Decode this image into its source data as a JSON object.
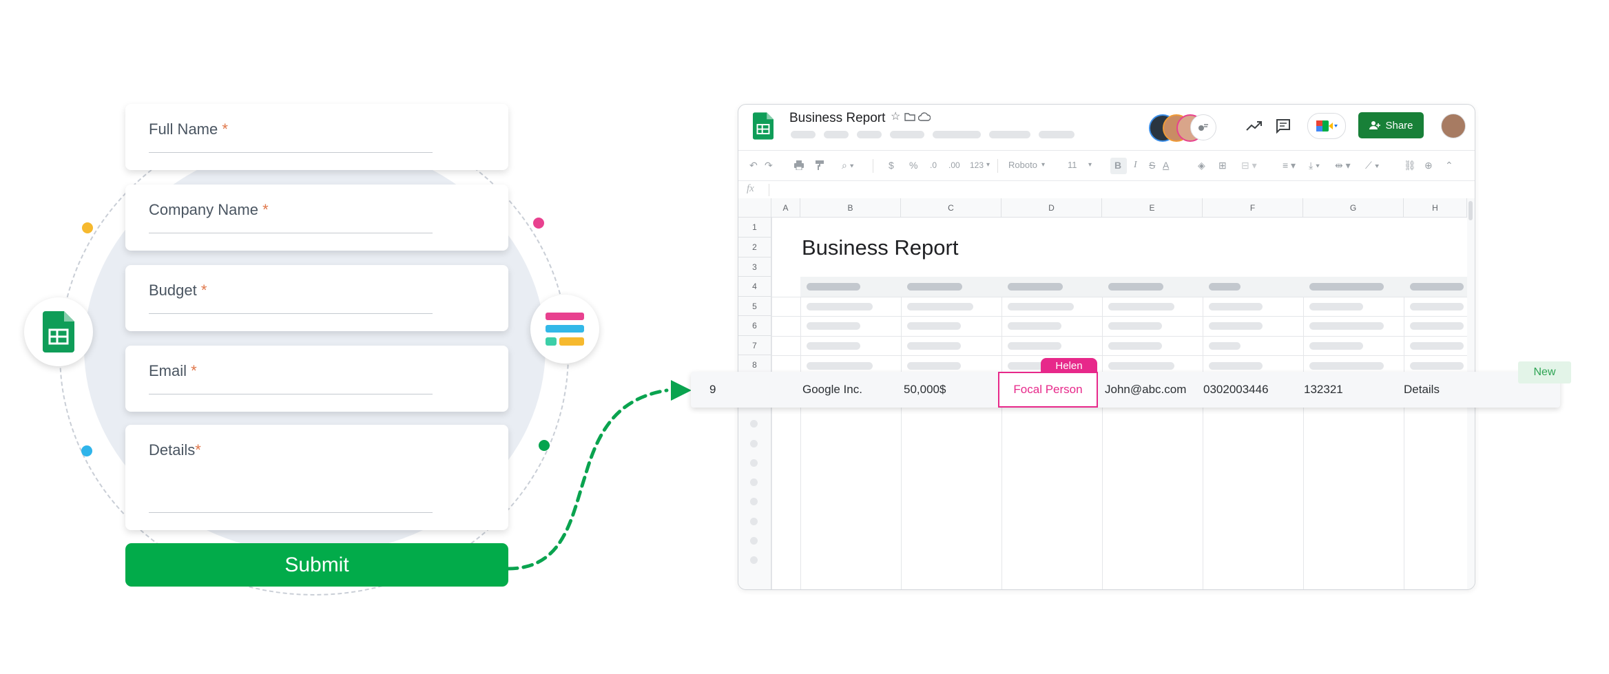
{
  "form": {
    "fields": [
      {
        "label": "Full Name",
        "required": "*"
      },
      {
        "label": "Company Name",
        "required": "*"
      },
      {
        "label": "Budget ",
        "required": "*"
      },
      {
        "label": "Email",
        "required": "*"
      },
      {
        "label": "Details",
        "required": "*"
      }
    ],
    "submit_label": "Submit"
  },
  "sheet": {
    "doc_title": "Business Report",
    "share_label": "Share",
    "font_name": "Roboto",
    "font_size": "11",
    "fx_label": "fx",
    "report_heading": "Business Report",
    "columns": [
      "A",
      "B",
      "C",
      "D",
      "E",
      "F",
      "G",
      "H"
    ],
    "rows": [
      "1",
      "2",
      "3",
      "4",
      "5",
      "6",
      "7",
      "8"
    ],
    "new_row": {
      "row_number": "9",
      "company": "Google Inc.",
      "budget": "50,000$",
      "contact": "Focal Person",
      "email": "John@abc.com",
      "phone": "0302003446",
      "id": "132321",
      "details": "Details"
    },
    "collaborator_tag": "Helen",
    "new_tag": "New",
    "toolbar": {
      "currency": "$",
      "percent": "%",
      "dec_decrease": ".0",
      "dec_increase": ".00",
      "number_format": "123"
    }
  },
  "colors": {
    "submit_green": "#02ab4a",
    "sheets_green": "#0f9d58",
    "highlight_pink": "#e7288a",
    "arrow_green": "#0aa34f"
  }
}
